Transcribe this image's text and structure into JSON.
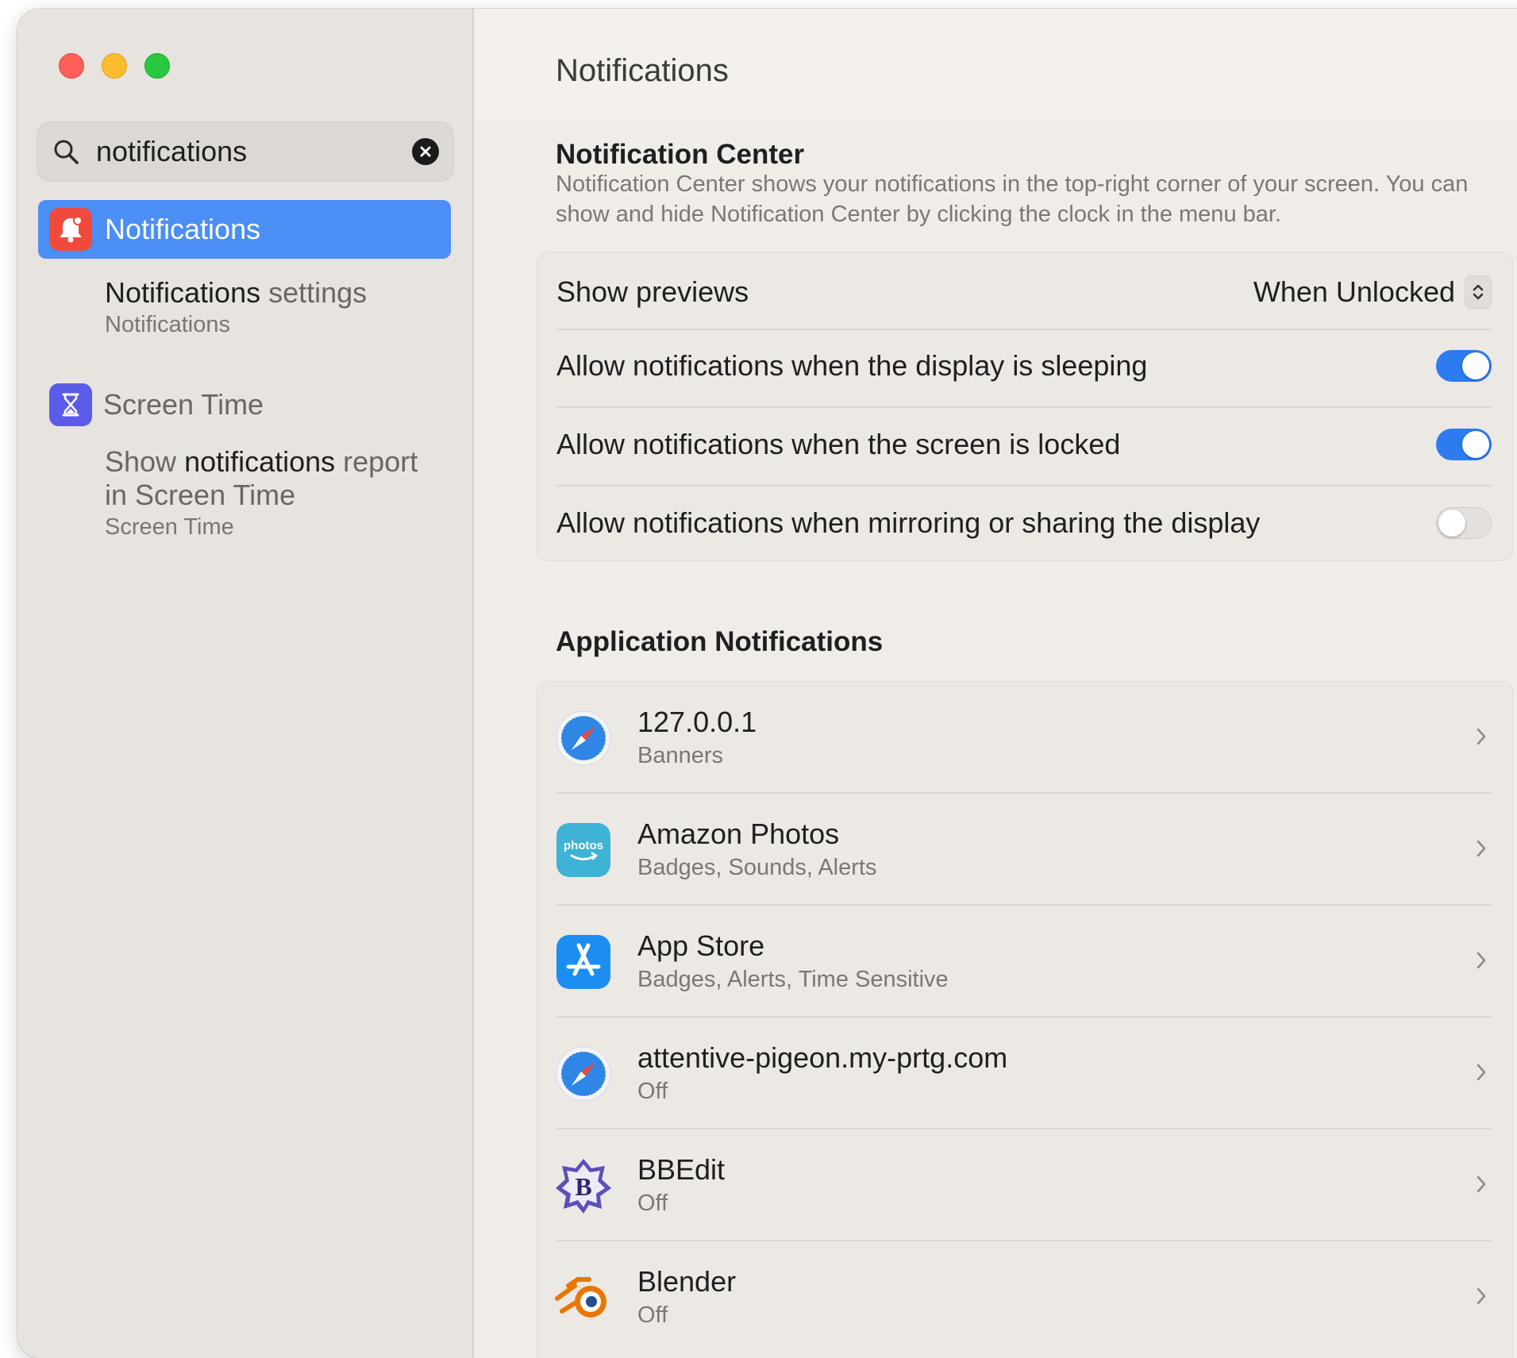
{
  "sidebar": {
    "search": {
      "value": "notifications"
    },
    "results": {
      "selected": {
        "label": "Notifications",
        "icon": "notifications-bell-icon",
        "icon_color": "#f04a3c"
      },
      "notifications_settings": {
        "title_bold": "Notifications",
        "title_rest": " settings",
        "caption": "Notifications"
      },
      "screen_time": {
        "label": "Screen Time",
        "icon": "hourglass-icon",
        "icon_color": "#5a5be8"
      },
      "screen_time_report": {
        "pre": "Show ",
        "bold": "notifications",
        "post": " report",
        "line2": "in Screen Time",
        "caption": "Screen Time"
      }
    }
  },
  "main": {
    "title": "Notifications",
    "notification_center": {
      "title": "Notification Center",
      "description": "Notification Center shows your notifications in the top-right corner of your screen. You can show and hide Notification Center by clicking the clock in the menu bar.",
      "show_previews": {
        "label": "Show previews",
        "value": "When Unlocked"
      },
      "toggles": [
        {
          "label": "Allow notifications when the display is sleeping",
          "on": true
        },
        {
          "label": "Allow notifications when the screen is locked",
          "on": true
        },
        {
          "label": "Allow notifications when mirroring or sharing the display",
          "on": false
        }
      ]
    },
    "application_notifications": {
      "title": "Application Notifications",
      "apps": [
        {
          "name": "127.0.0.1",
          "status": "Banners",
          "icon": "safari-compass-icon"
        },
        {
          "name": "Amazon Photos",
          "status": "Badges, Sounds, Alerts",
          "icon": "amazon-photos-icon",
          "icon_text": "photos"
        },
        {
          "name": "App Store",
          "status": "Badges, Alerts, Time Sensitive",
          "icon": "app-store-icon"
        },
        {
          "name": "attentive-pigeon.my-prtg.com",
          "status": "Off",
          "icon": "safari-compass-icon"
        },
        {
          "name": "BBEdit",
          "status": "Off",
          "icon": "bbedit-icon",
          "icon_text": "B"
        },
        {
          "name": "Blender",
          "status": "Off",
          "icon": "blender-icon"
        }
      ]
    }
  },
  "colors": {
    "accent": "#2d7bf0",
    "selection": "#4b8ef5"
  }
}
